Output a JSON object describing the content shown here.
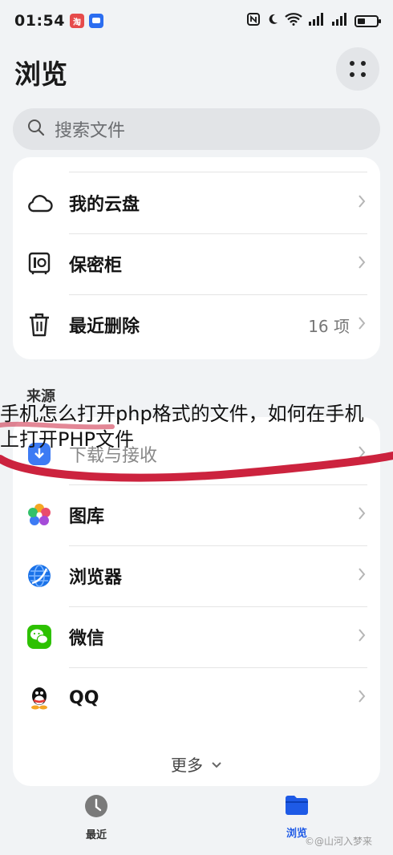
{
  "status_bar": {
    "time": "01:54",
    "app_icon_1_color": "#e64b4b",
    "app_icon_2_color": "#2b6df0"
  },
  "header": {
    "title": "浏览",
    "more_icon": "dots-grid-icon"
  },
  "search": {
    "placeholder": "搜索文件"
  },
  "locations": [
    {
      "label": "我的云盘",
      "icon": "cloud-icon"
    },
    {
      "label": "保密柜",
      "icon": "safe-icon"
    },
    {
      "label": "最近删除",
      "icon": "trash-icon",
      "count": "16 项"
    }
  ],
  "sources": {
    "title": "来源",
    "items": [
      {
        "label": "下载与接收",
        "icon": "download-icon"
      },
      {
        "label": "图库",
        "icon": "gallery-icon"
      },
      {
        "label": "浏览器",
        "icon": "browser-icon"
      },
      {
        "label": "微信",
        "icon": "wechat-icon"
      },
      {
        "label": "QQ",
        "icon": "qq-icon"
      }
    ],
    "more_label": "更多"
  },
  "tabs": {
    "recent": "最近",
    "browse": "浏览",
    "active_color": "#1e5ae6"
  },
  "overlay": {
    "line1": "手机怎么打开php格式的文件，如何在手机",
    "line2": "上打开PHP文件"
  },
  "watermark": "©@山河入梦来"
}
